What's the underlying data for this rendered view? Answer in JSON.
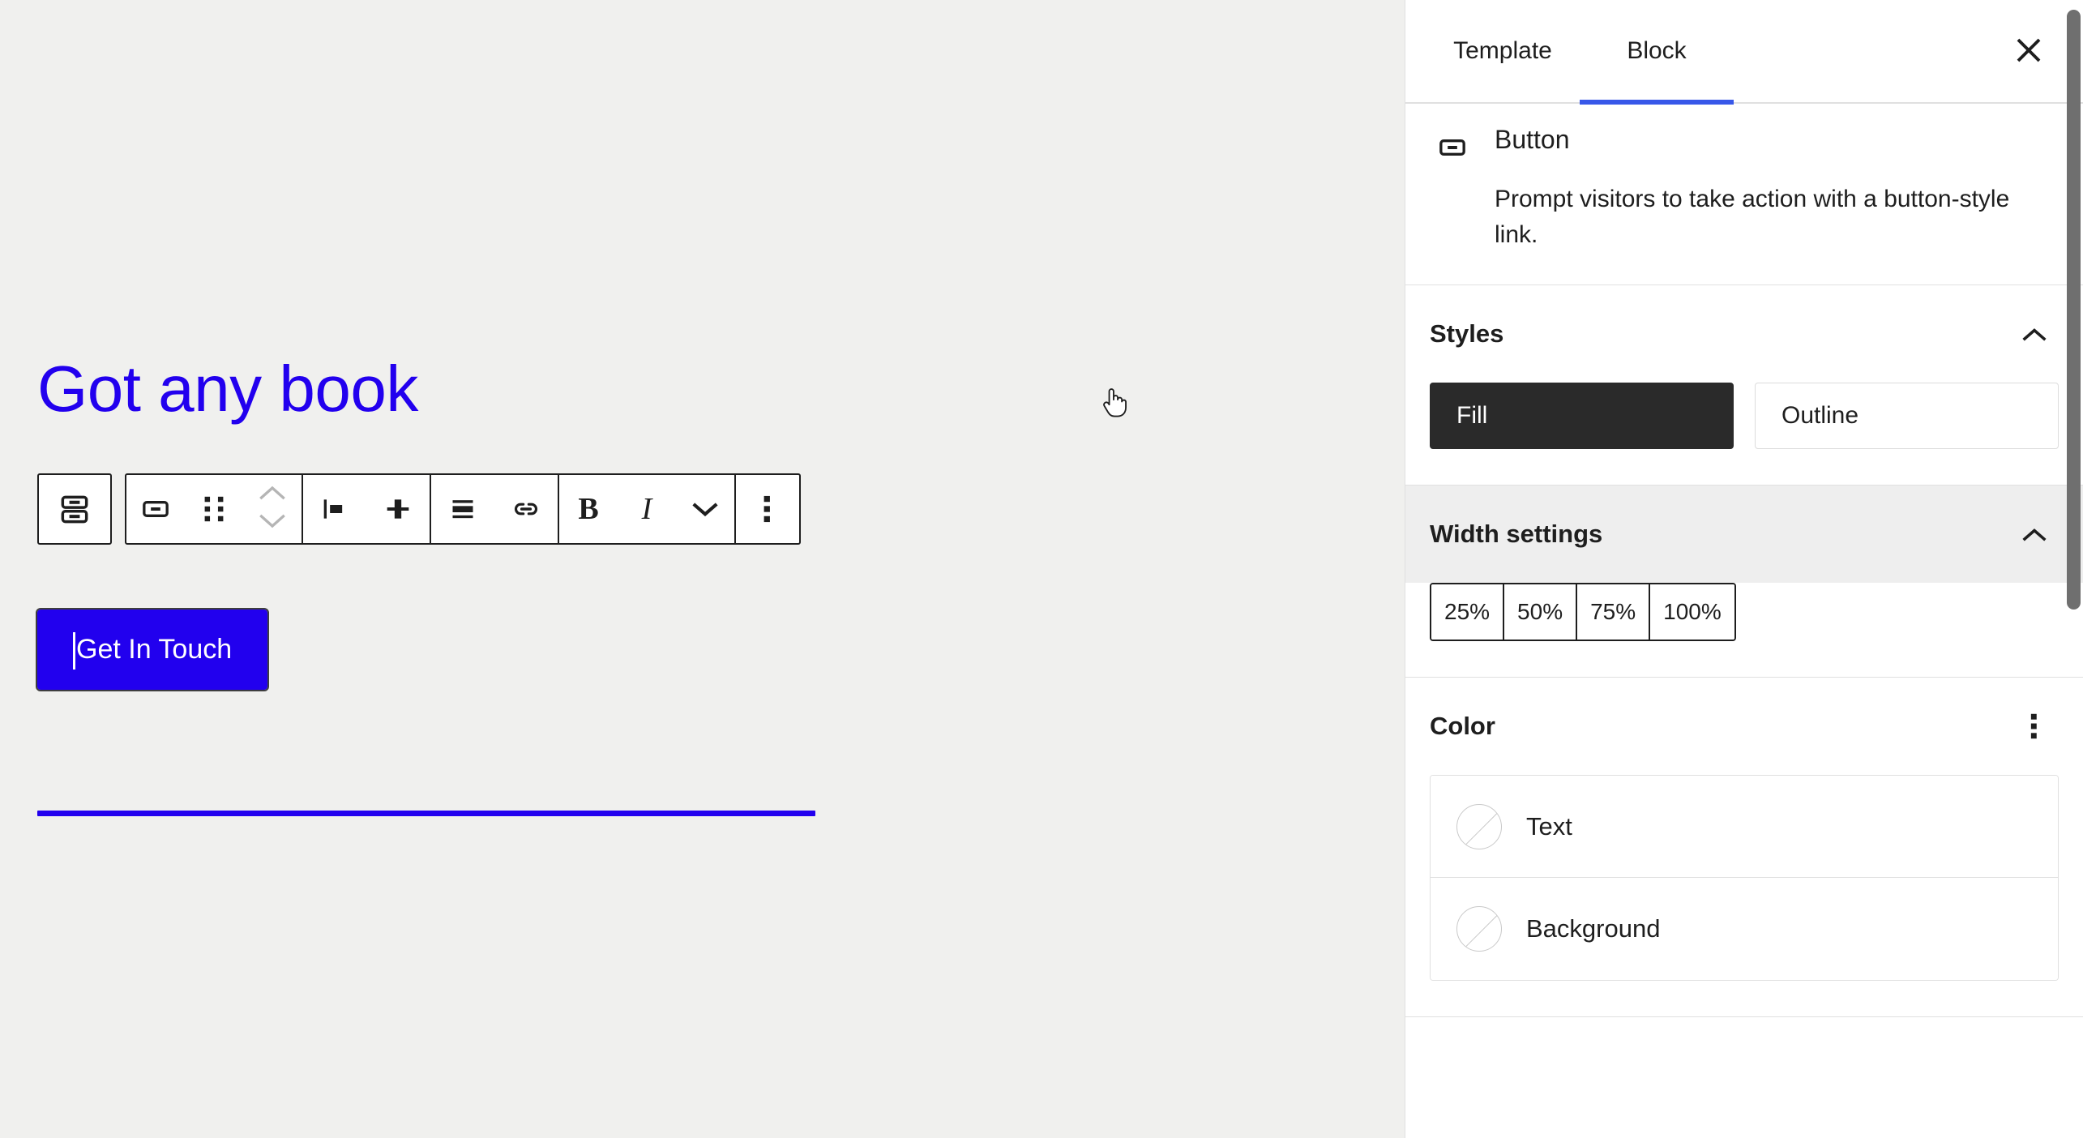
{
  "canvas": {
    "heading": "Got any book",
    "button_label": "Get In Touch",
    "accent_color": "#2200ee",
    "background_color": "#f0f0ee",
    "separator": "horizontal-rule"
  },
  "toolbar": {
    "items": [
      {
        "name": "select-parent-buttons-block",
        "icon": "buttons-stack-icon",
        "label": "Buttons"
      },
      {
        "name": "block-type-button",
        "icon": "button-icon",
        "label": "Button"
      },
      {
        "name": "drag-handle",
        "icon": "drag-dots-icon",
        "label": "Drag"
      },
      {
        "name": "move-up",
        "icon": "chevron-up-icon",
        "label": "Move up",
        "disabled": true
      },
      {
        "name": "move-down",
        "icon": "chevron-down-icon",
        "label": "Move down",
        "disabled": true
      },
      {
        "name": "align-left",
        "icon": "align-left-icon",
        "label": "Align left"
      },
      {
        "name": "align-center",
        "icon": "align-center-icon",
        "label": "Align center"
      },
      {
        "name": "text-align",
        "icon": "text-align-center-icon",
        "label": "Text align"
      },
      {
        "name": "link",
        "icon": "link-icon",
        "label": "Link"
      },
      {
        "name": "bold",
        "icon": "bold-icon",
        "label": "B"
      },
      {
        "name": "italic",
        "icon": "italic-icon",
        "label": "I"
      },
      {
        "name": "more-rich-text",
        "icon": "chevron-down-icon",
        "label": "More"
      },
      {
        "name": "block-options",
        "icon": "three-dots-vertical-icon",
        "label": "Options"
      }
    ],
    "bold_glyph": "B",
    "italic_glyph": "I"
  },
  "sidebar": {
    "tabs": [
      {
        "label": "Template",
        "active": false
      },
      {
        "label": "Block",
        "active": true
      }
    ],
    "close_label": "Close settings",
    "active_underline_color": "#3858e9",
    "block": {
      "icon": "button-icon",
      "title": "Button",
      "description": "Prompt visitors to take action with a button-style link."
    },
    "panels": [
      {
        "id": "styles",
        "title": "Styles",
        "expanded": true,
        "control": "chevron-up-icon",
        "options": [
          {
            "label": "Fill",
            "selected": true
          },
          {
            "label": "Outline",
            "selected": false
          }
        ]
      },
      {
        "id": "width-settings",
        "title": "Width settings",
        "expanded": true,
        "hovered": true,
        "control": "chevron-up-icon",
        "widths": [
          "25%",
          "50%",
          "75%",
          "100%"
        ]
      },
      {
        "id": "color",
        "title": "Color",
        "expanded": true,
        "control": "three-dots-vertical-icon",
        "rows": [
          {
            "label": "Text",
            "swatch": "none"
          },
          {
            "label": "Background",
            "swatch": "none"
          }
        ]
      }
    ],
    "selected_style_bg": "#2a2a2a"
  },
  "cursor": {
    "type": "pointer-hand"
  }
}
